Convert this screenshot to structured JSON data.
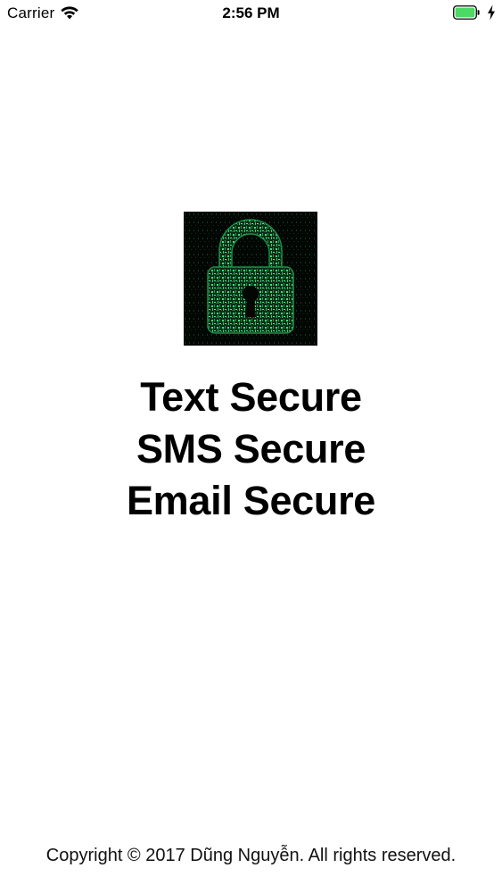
{
  "status_bar": {
    "carrier": "Carrier",
    "time": "2:56 PM",
    "icons": [
      "wifi-icon",
      "battery-icon",
      "charging-bolt-icon"
    ],
    "battery_color": "#4cd964"
  },
  "logo": {
    "icon": "padlock-icon",
    "background_color": "#030a05",
    "matrix_color": "#2fcf6a"
  },
  "headlines": {
    "line1": "Text Secure",
    "line2": "SMS Secure",
    "line3": "Email Secure"
  },
  "footer": {
    "copyright": "Copyright © 2017 Dũng Nguyễn. All rights reserved."
  }
}
